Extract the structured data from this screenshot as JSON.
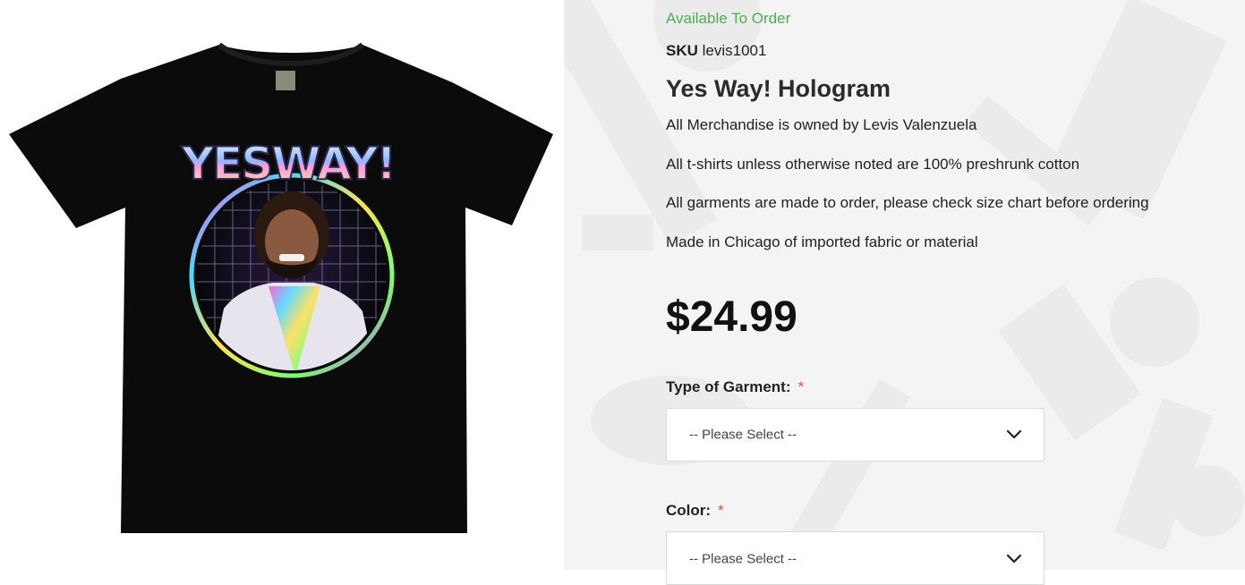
{
  "product": {
    "availability": "Available To Order",
    "sku_label": "SKU",
    "sku_value": "levis1001",
    "title": "Yes Way! Hologram",
    "notes": [
      "All Merchandise is owned by Levis Valenzuela",
      "All t-shirts unless otherwise noted are 100% preshrunk cotton",
      "All garments are made to order, please check size chart before ordering",
      "Made in Chicago of imported fabric or material"
    ],
    "price": "$24.99",
    "shirt_graphic_text": "YESWAY!"
  },
  "options": {
    "garment": {
      "label": "Type of Garment:",
      "required_mark": "*",
      "selected": "-- Please Select --"
    },
    "color": {
      "label": "Color:",
      "required_mark": "*",
      "selected": "-- Please Select --"
    }
  },
  "colors": {
    "availability": "#4caf50",
    "required": "#d9534f",
    "background_pattern": "#f4f4f4"
  },
  "icons": {
    "select_arrow": "chevron-down-icon"
  }
}
